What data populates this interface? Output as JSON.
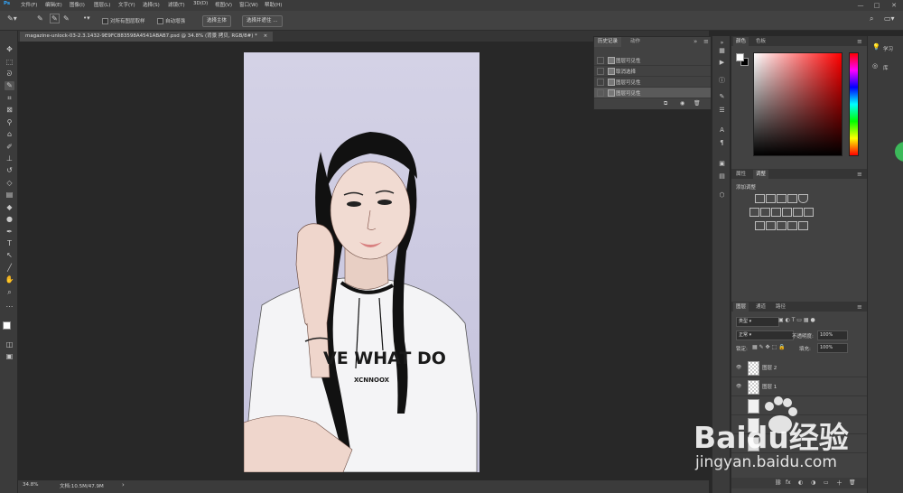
{
  "menubar": {
    "app_icon": "ps-logo-icon",
    "items": [
      "文件(F)",
      "编辑(E)",
      "图像(I)",
      "图层(L)",
      "文字(Y)",
      "选择(S)",
      "滤镜(T)",
      "3D(D)",
      "视图(V)",
      "窗口(W)",
      "帮助(H)"
    ],
    "window_controls": [
      "—",
      "□",
      "✕"
    ]
  },
  "options_bar": {
    "sample_all_layers": "对所有图层取样",
    "auto_enhance": "自动增强",
    "select_subject": "选择主体",
    "select_and_mask": "选择并遮住 ..."
  },
  "document": {
    "tab_title": "magazine-unlock-03-2.3.1432-9E9FC883598A4541ABAB7.psd @ 34.8% (背景 拷贝, RGB/8#) *",
    "close_glyph": "×",
    "photo_shirt_text": "VE WHAT DO",
    "photo_shirt_subtext": "XCNNOOX"
  },
  "status": {
    "zoom": "34.8%",
    "doc_size": "文档:10.5M/47.9M",
    "arrow": "›"
  },
  "history_panel": {
    "tabs": [
      "历史记录",
      "动作"
    ],
    "collapse_glyph": "»",
    "menu_glyph": "≡",
    "items": [
      "图层可见性",
      "取消选择",
      "图层可见性",
      "图层可见性"
    ],
    "bottom_icons": [
      "⧉",
      "◉",
      "🗑"
    ]
  },
  "color_panel": {
    "tabs": [
      "颜色",
      "色板"
    ],
    "menu_glyph": "≡",
    "base_hue": "#ff0000"
  },
  "adjustments_panel": {
    "tabs": [
      "属性",
      "调整"
    ],
    "menu_glyph": "≡",
    "heading": "添加调整"
  },
  "layers_panel": {
    "tabs": [
      "图层",
      "通道",
      "路径"
    ],
    "menu_glyph": "≡",
    "filter_kind": "类型",
    "blend_mode": "正常",
    "opacity_label": "不透明度:",
    "opacity_value": "100%",
    "lock_label": "锁定:",
    "fill_label": "填充:",
    "fill_value": "100%",
    "layers": [
      {
        "name": "图层 2",
        "visible": true
      },
      {
        "name": "图层 1",
        "visible": true
      },
      {
        "name": "",
        "visible": false
      },
      {
        "name": "",
        "visible": false
      },
      {
        "name": "",
        "visible": false
      }
    ],
    "bottom_icons": [
      "⛓",
      "fx",
      "◐",
      "◑",
      "▭",
      "＋",
      "🗑"
    ]
  },
  "learn_panel": {
    "learn_label": "学习",
    "library_label": "库"
  },
  "watermark": {
    "brand": "Baidu经验",
    "url": "jingyan.baidu.com"
  }
}
